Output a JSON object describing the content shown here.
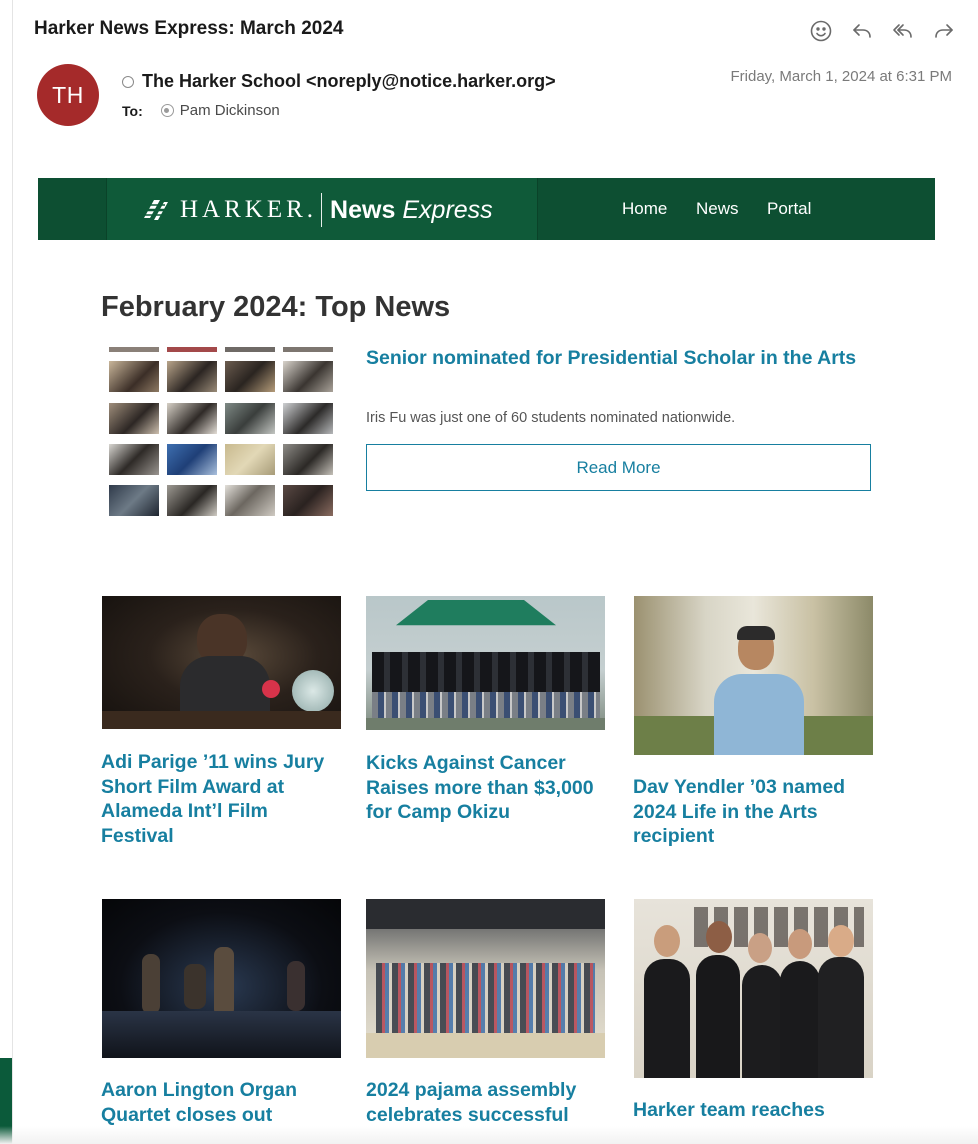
{
  "email": {
    "subject": "Harker News Express: March 2024",
    "sender_initials": "TH",
    "sender": "The Harker School <noreply@notice.harker.org>",
    "date": "Friday, March 1, 2024 at 6:31 PM",
    "to_label": "To:",
    "to_name": "Pam Dickinson",
    "toolbar_icons": [
      "emoji-icon",
      "reply-icon",
      "reply-all-icon",
      "forward-icon"
    ]
  },
  "banner": {
    "logo_harker": "HARKER.",
    "logo_news": "News",
    "logo_express": "Express",
    "nav": [
      "Home",
      "News",
      "Portal"
    ]
  },
  "top_news": {
    "section_title": "February 2024: Top News",
    "featured": {
      "title": "Senior nominated for Presidential Scholar in the Arts",
      "description": "Iris Fu was just one of 60 students nominated nationwide.",
      "button": "Read More"
    }
  },
  "articles": [
    {
      "title": "Adi Parige ’11 wins Jury Short Film Award at Alameda Int’l Film Festival"
    },
    {
      "title": "Kicks Against Cancer Raises more than $3,000 for Camp Okizu"
    },
    {
      "title": "Dav Yendler ’03 named 2024 Life in the Arts recipient"
    },
    {
      "title": "Aaron Lington Organ Quartet closes out"
    },
    {
      "title": "2024 pajama assembly celebrates successful"
    },
    {
      "title": "Harker team reaches"
    }
  ],
  "colors": {
    "banner_green": "#0d4f32",
    "link_teal": "#177fa0",
    "avatar_red": "#a52a2a"
  }
}
